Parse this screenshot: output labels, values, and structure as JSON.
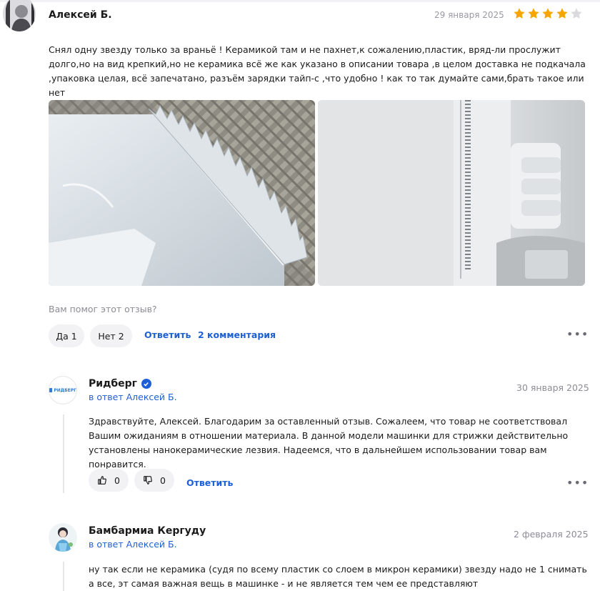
{
  "review": {
    "author": "Алексей Б.",
    "date": "29 января 2025",
    "rating": 4,
    "rating_max": 5,
    "text": "Снял одну звезду только за враньё ! Керамикой там и не пахнет,к сожалению,пластик, вряд-ли прослужит долго,но на вид крепкий,но не керамика всё же как указано в описании товара ,в целом доставка не подкачала ,упаковка целая, всё запечатано, разъём зарядки тайп-с ,что удобно ! как то так думайте сами,брать такое или нет",
    "helpful_question": "Вам помог этот отзыв?",
    "yes_label": "Да 1",
    "no_label": "Нет 2",
    "reply_label": "Ответить",
    "comments_label": "2 комментария",
    "more_icon": "more-horizontal-icon"
  },
  "replies": [
    {
      "name": "Ридберг",
      "verified": true,
      "reply_to": "в ответ Алексей Б.",
      "date": "30 января 2025",
      "avatar_text": "РИДБЕРГ",
      "text": "Здравствуйте, Алексей. Благодарим за оставленный отзыв. Сожалеем, что товар не соответствовал Вашим ожиданиям в отношении материала. В данной модели машинки для стрижки действительно установлены нанокерамические лезвия. Надеемся, что в дальнейшем использовании товар вам понравится.",
      "likes": "0",
      "dislikes": "0",
      "reply_label": "Ответить"
    },
    {
      "name": "Бамбармиа Кергуду",
      "reply_to": "в ответ Алексей Б.",
      "date": "2 февраля 2025",
      "text": "ну так если не керамика (судя по всему пластик со слоем в микрон керамики) звезду надо не 1 снимать а все, эт самая важная вещь в машинке - и не является тем чем ее представляют"
    }
  ],
  "colors": {
    "star_active": "#f7a600",
    "star_inactive": "#d9d9de",
    "link": "#1f5fd6",
    "pill_bg": "#f2f2f5"
  }
}
